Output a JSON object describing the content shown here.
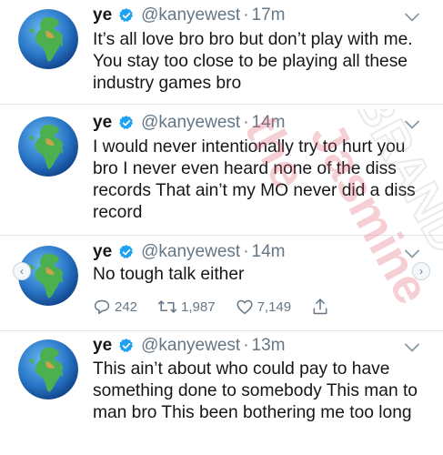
{
  "tweets": [
    {
      "name": "ye",
      "handle": "@kanyewest",
      "sep": "·",
      "time": "17m",
      "text": "It’s all love bro bro but don’t play with me.  You stay too close to be playing all these industry games bro"
    },
    {
      "name": "ye",
      "handle": "@kanyewest",
      "sep": "·",
      "time": "14m",
      "text": "I would never intentionally try to hurt you bro    I never even heard none of the diss records      That ain’t my MO  never did a diss record"
    },
    {
      "name": "ye",
      "handle": "@kanyewest",
      "sep": "·",
      "time": "14m",
      "text": "No tough talk either",
      "replies": "242",
      "retweets": "1,987",
      "likes": "7,149"
    },
    {
      "name": "ye",
      "handle": "@kanyewest",
      "sep": "·",
      "time": "13m",
      "text": "This ain’t about who could pay to have something done to somebody    This man to man bro    This been bothering me too long"
    }
  ],
  "colors": {
    "text": "#14171a",
    "secondary": "#657786",
    "verified": "#1da1f2",
    "divider": "#e1e8ed",
    "watermark": "#e0556b"
  },
  "icons": [
    "globe-avatar",
    "verified-badge-icon",
    "chevron-down-icon",
    "reply-icon",
    "retweet-icon",
    "like-icon",
    "share-icon"
  ],
  "watermark_text": "the Jasmine BRAND"
}
